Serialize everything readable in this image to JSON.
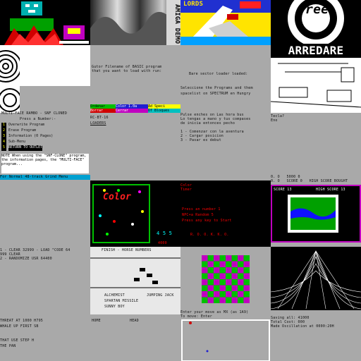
{
  "tiles": {
    "lords_title": "LORDS",
    "wave_title": "AMIGA DEMO",
    "arredare_logo_top": "free",
    "arredare_title": "ARREDARE",
    "basic_info": {
      "line1": "Gutor Filename of BASIC program",
      "line2": "that you want to load with run:",
      "line3": "Bare sector loader loaded:",
      "line4": "Seleccione the Programs and them",
      "line5": "spacelist on SPECTRUM en Hungry"
    },
    "menu_panel": {
      "title": "MULTI-FACE RAMBO - SNF CLONED",
      "prompt": "Press a Number:-",
      "items": [
        {
          "key": "1",
          "label": "Overwrite Program"
        },
        {
          "key": "2",
          "label": "Erase Program"
        },
        {
          "key": "3",
          "label": "Information (0 Pages)"
        },
        {
          "key": "4",
          "label": "Sub-Menu"
        },
        {
          "key": "5",
          "label": "RETURN TO OUTLET"
        }
      ],
      "note": "NOTE When using the \"SNF-CLONE\" program, the information pages, the \"MULTI-FACE\" program...",
      "footer": "For Normal 48-track Grind Menu"
    },
    "color_bar_labels": [
      "Ordenar",
      "Color 1.0a",
      "Ad Speci"
    ],
    "color_bar_row2": [
      "Borrar",
      "Cerrar",
      "Of Bloques"
    ],
    "small_labels": [
      "RC-BT-16",
      "LOADERS"
    ],
    "spanish_text": {
      "line1": "Pulse enches on Las hora bus",
      "line2": "Lo tengas a mano y tus compases",
      "line3": "de inicia entonces pecho",
      "line4": "1 - Comenzar con la aventura",
      "line5": "2 - Cargar posicion",
      "line6": "3 - Pasar es debut"
    },
    "room_caption": [
      "Tecla?",
      "Eno"
    ],
    "color_game_title": "Color",
    "color_game_scores": [
      "4 5 5",
      "4000"
    ],
    "red_menu": {
      "title_top": "Color",
      "title_bottom": "Timer",
      "items": [
        "Press an number 1",
        "NPC+a Random 5",
        "Press any key to Start"
      ],
      "bottom": "R. O. O. K. K. O."
    },
    "hiscore_panel": {
      "top": "0. O   5000 0",
      "header": "0. O   SCORE 0   HIGH SCORE BOUGHT",
      "score": "SCORE 13",
      "high": "HIGH SCORE 13"
    },
    "loader_text": {
      "line1": "1 - CLEAR 32999 - LOAD \"CODE 64",
      "line2": "999 CLEAR",
      "line3": "2 - RANDOMIZE USR 64400",
      "line4": "THREAT AT 1000 H795",
      "line5": "WHALE UP FIRST SB",
      "line6": "THAT USE STEP H",
      "line7": "THE PAN"
    },
    "race_screen": {
      "header": "FINISH - HORSE NUMBERS",
      "names": [
        "ALCHEMIST",
        "JUMPING JACK",
        "SPARTAN MISSILE",
        "SUNNY BOY"
      ]
    },
    "chess_prompt": {
      "line1": "Enter your move as MX (as 1A9)",
      "line2": "To move: Enter"
    },
    "grid_footer": {
      "line1": "Saving all: 41000",
      "line2": "Total Cost: 000",
      "line3": "Made Oscillation at 0000:20H"
    },
    "bottom_small": [
      "HOME",
      "HEAD"
    ]
  }
}
